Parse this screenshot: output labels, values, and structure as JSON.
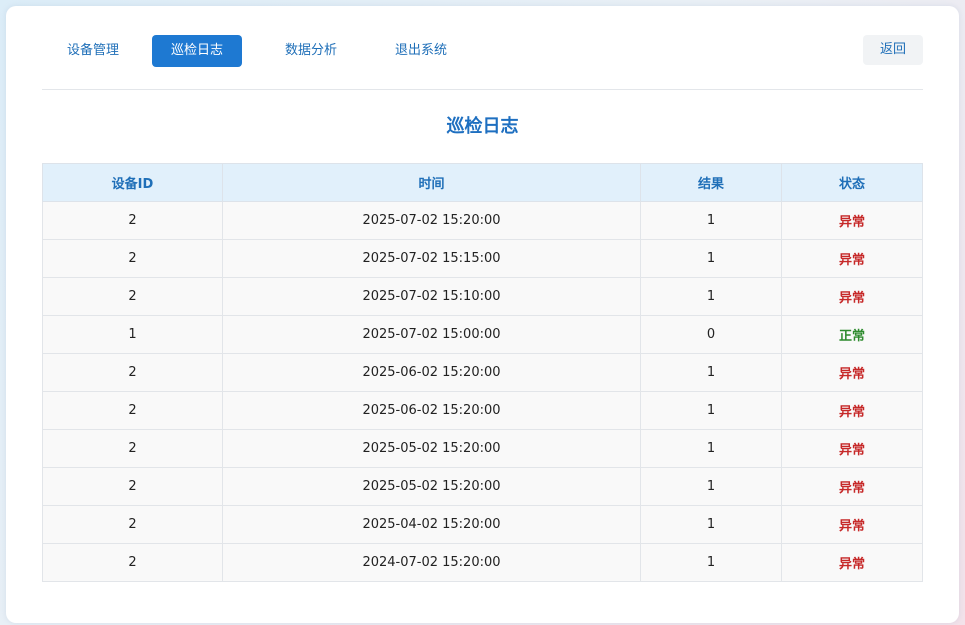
{
  "nav": {
    "items": [
      {
        "label": "设备管理",
        "active": false
      },
      {
        "label": "巡检日志",
        "active": true
      },
      {
        "label": "数据分析",
        "active": false
      },
      {
        "label": "退出系统",
        "active": false
      }
    ],
    "back_label": "返回"
  },
  "page_title": "巡检日志",
  "table": {
    "columns": [
      "设备ID",
      "时间",
      "结果",
      "状态"
    ],
    "rows": [
      {
        "device_id": "2",
        "time": "2025-07-02 15:20:00",
        "result": "1",
        "status": "异常",
        "status_type": "abnormal"
      },
      {
        "device_id": "2",
        "time": "2025-07-02 15:15:00",
        "result": "1",
        "status": "异常",
        "status_type": "abnormal"
      },
      {
        "device_id": "2",
        "time": "2025-07-02 15:10:00",
        "result": "1",
        "status": "异常",
        "status_type": "abnormal"
      },
      {
        "device_id": "1",
        "time": "2025-07-02 15:00:00",
        "result": "0",
        "status": "正常",
        "status_type": "normal"
      },
      {
        "device_id": "2",
        "time": "2025-06-02 15:20:00",
        "result": "1",
        "status": "异常",
        "status_type": "abnormal"
      },
      {
        "device_id": "2",
        "time": "2025-06-02 15:20:00",
        "result": "1",
        "status": "异常",
        "status_type": "abnormal"
      },
      {
        "device_id": "2",
        "time": "2025-05-02 15:20:00",
        "result": "1",
        "status": "异常",
        "status_type": "abnormal"
      },
      {
        "device_id": "2",
        "time": "2025-05-02 15:20:00",
        "result": "1",
        "status": "异常",
        "status_type": "abnormal"
      },
      {
        "device_id": "2",
        "time": "2025-04-02 15:20:00",
        "result": "1",
        "status": "异常",
        "status_type": "abnormal"
      },
      {
        "device_id": "2",
        "time": "2024-07-02 15:20:00",
        "result": "1",
        "status": "异常",
        "status_type": "abnormal"
      }
    ]
  },
  "colors": {
    "accent": "#1e79d2",
    "title": "#1e6fc0",
    "status_abnormal": "#c62828",
    "status_normal": "#2e8b2e",
    "header_bg": "#e1f0fb"
  }
}
